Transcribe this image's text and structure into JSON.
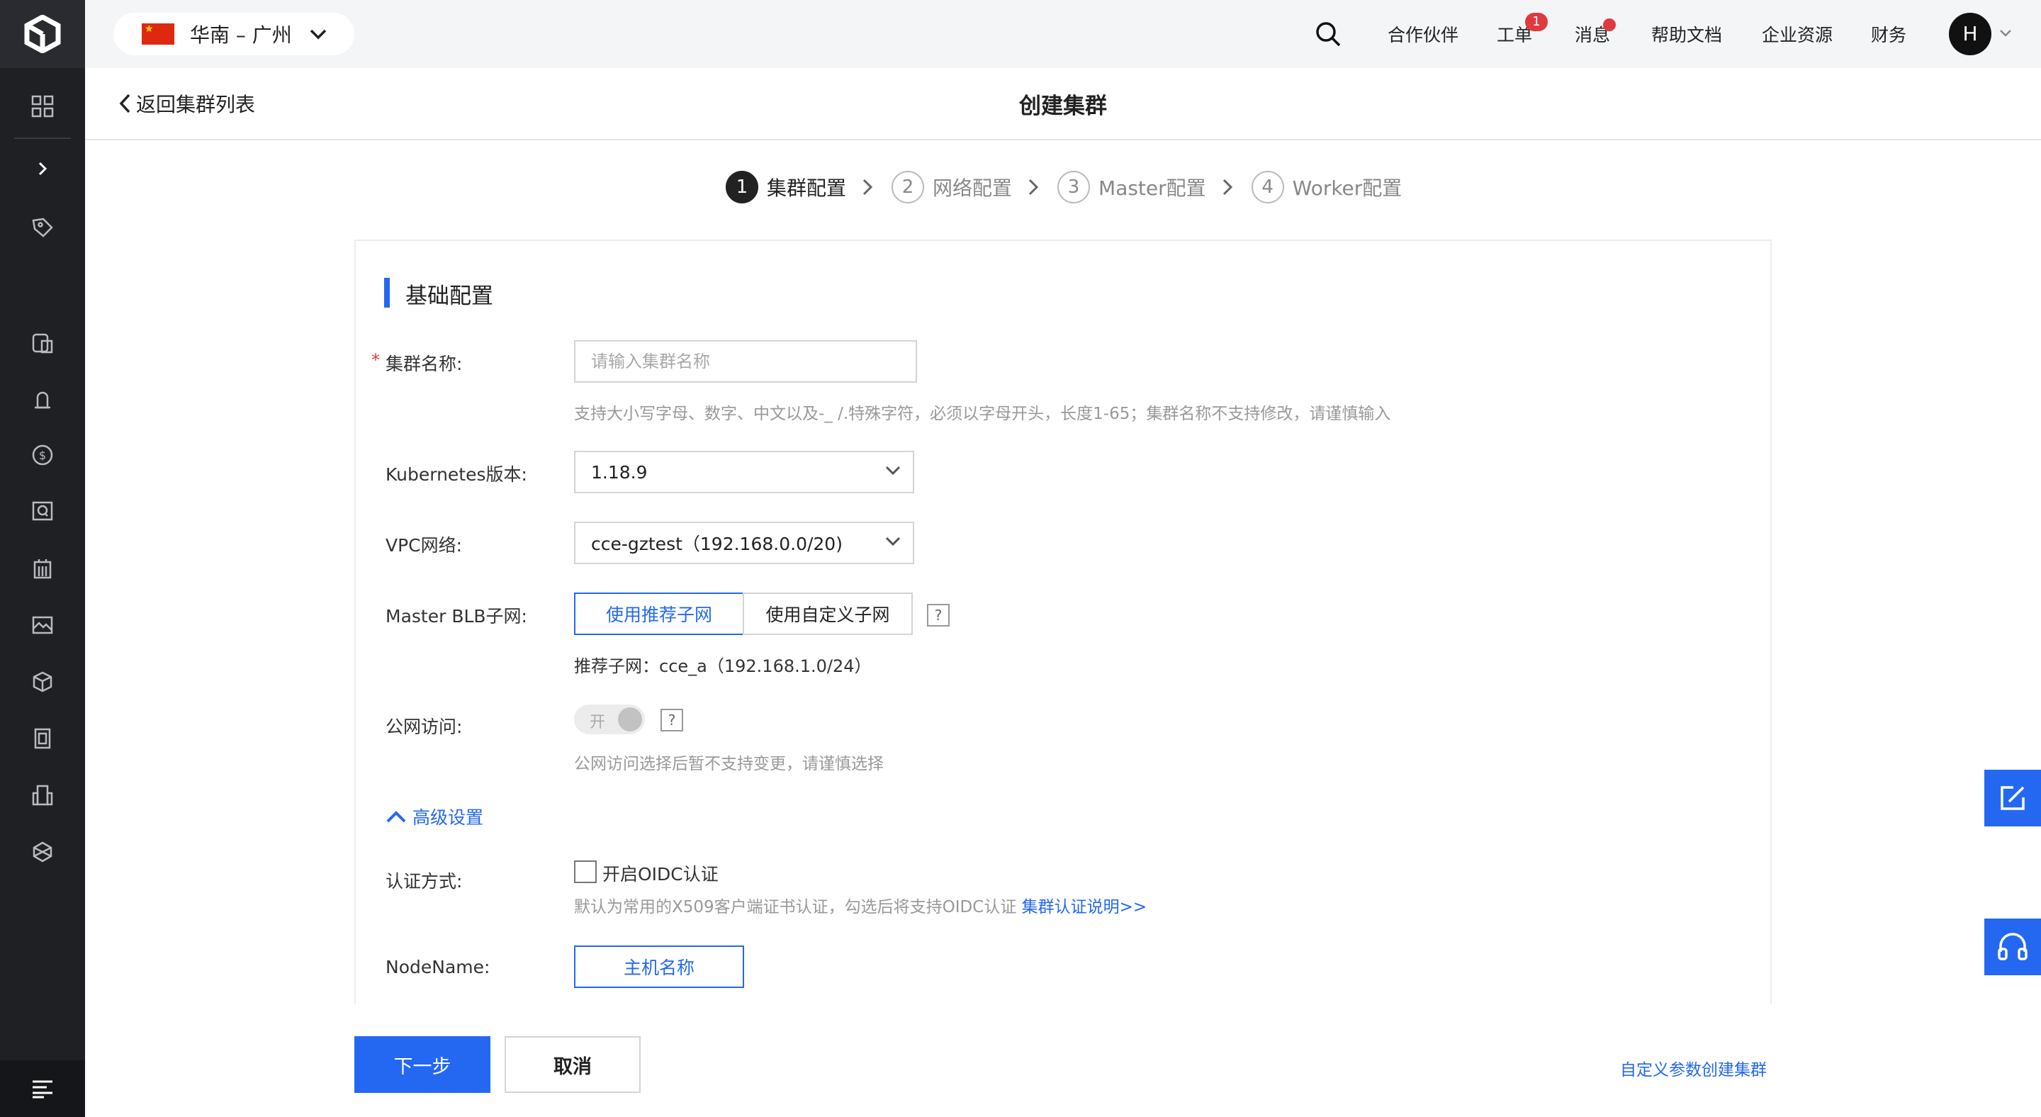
{
  "header": {
    "region": "华南 – 广州",
    "nav": {
      "partners": "合作伙伴",
      "tickets": "工单",
      "tickets_badge": "1",
      "messages": "消息",
      "docs": "帮助文档",
      "enterprise": "企业资源",
      "finance": "财务"
    },
    "avatar_initial": "H"
  },
  "subheader": {
    "back_label": "返回集群列表",
    "title": "创建集群"
  },
  "steps": [
    {
      "num": "1",
      "label": "集群配置"
    },
    {
      "num": "2",
      "label": "网络配置"
    },
    {
      "num": "3",
      "label": "Master配置"
    },
    {
      "num": "4",
      "label": "Worker配置"
    }
  ],
  "form": {
    "section_title": "基础配置",
    "cluster_name": {
      "label": "集群名称:",
      "placeholder": "请输入集群名称",
      "hint": "支持大小写字母、数字、中文以及-_ /.特殊字符，必须以字母开头，长度1-65；集群名称不支持修改，请谨慎输入"
    },
    "k8s_version": {
      "label": "Kubernetes版本:",
      "value": "1.18.9"
    },
    "vpc": {
      "label": "VPC网络:",
      "value": "cce-gztest（192.168.0.0/20)"
    },
    "blb_subnet": {
      "label": "Master BLB子网:",
      "option_recommended": "使用推荐子网",
      "option_custom": "使用自定义子网",
      "help": "?",
      "recommended_text": "推荐子网：cce_a（192.168.1.0/24）"
    },
    "public_access": {
      "label": "公网访问:",
      "toggle_text": "开",
      "help": "?",
      "hint": "公网访问选择后暂不支持变更，请谨慎选择"
    },
    "advanced_label": "高级设置",
    "auth": {
      "label": "认证方式:",
      "checkbox_label": "开启OIDC认证",
      "hint": "默认为常用的X509客户端证书认证，勾选后将支持OIDC认证",
      "link": "集群认证说明>>"
    },
    "node_name": {
      "label": "NodeName:",
      "option": "主机名称"
    }
  },
  "footer": {
    "next": "下一步",
    "cancel": "取消",
    "custom_link": "自定义参数创建集群"
  },
  "colors": {
    "accent": "#2468f2",
    "sidebar": "#1f2024",
    "badge": "#e0393e"
  }
}
